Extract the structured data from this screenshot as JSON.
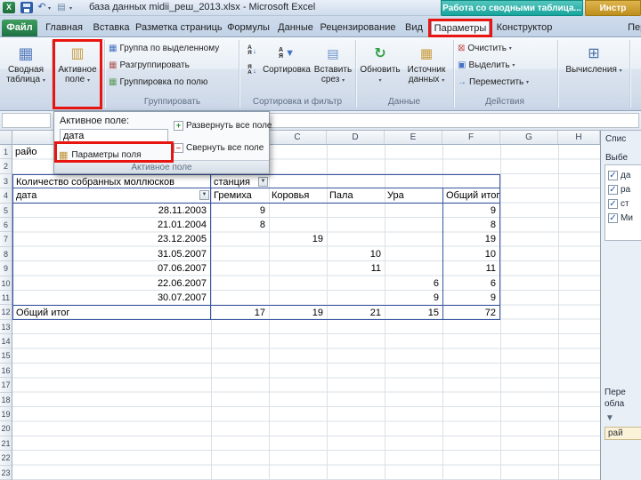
{
  "icons": {
    "logo_letter": "X",
    "undo": "↶",
    "caret": "▾",
    "dropdown_arrow": "▼",
    "check": "✓",
    "refresh": "↻",
    "plus": "+",
    "minus": "–",
    "arrow_down": "↓",
    "letter_a": "А",
    "letter_ya": "Я",
    "funnel": "▼",
    "clear_glyph": "⊠",
    "select_glyph": "▣",
    "move_glyph": "→",
    "grid_glyph": "▦",
    "calc_glyph": "⊞",
    "field_glyph": "▥",
    "settings_glyph": "▦",
    "sheet_glyph": "▤"
  },
  "titlebar": {
    "title": "база данных midii_реш_2013.xlsx - Microsoft Excel",
    "ctx_pivot": "Работа со сводными таблица...",
    "ctx_other": "Инстр"
  },
  "tabs": [
    {
      "label": "Файл",
      "kind": "file"
    },
    {
      "label": "Главная",
      "kind": "plain"
    },
    {
      "label": "Вставка",
      "kind": "plain"
    },
    {
      "label": "Разметка страницы",
      "kind": "plain"
    },
    {
      "label": "Формулы",
      "kind": "plain"
    },
    {
      "label": "Данные",
      "kind": "plain"
    },
    {
      "label": "Рецензирование",
      "kind": "plain"
    },
    {
      "label": "Вид",
      "kind": "plain"
    },
    {
      "label": "Параметры",
      "kind": "active"
    },
    {
      "label": "Конструктор",
      "kind": "plain"
    },
    {
      "label": "Перь",
      "kind": "plain"
    }
  ],
  "ribbon": {
    "pivot_table": "Сводная таблица",
    "active_field": "Активное поле",
    "grouping": {
      "item1": "Группа по выделенному",
      "item2": "Разгруппировать",
      "item3": "Группировка по полю",
      "label": "Группировать"
    },
    "sorting": {
      "sort": "Сортировка",
      "slicer1": "Вставить",
      "slicer2": "срез",
      "label": "Сортировка и фильтр"
    },
    "data": {
      "refresh": "Обновить",
      "source1": "Источник",
      "source2": "данных",
      "label": "Данные"
    },
    "actions": {
      "item1": "Очистить",
      "item2": "Выделить",
      "item3": "Переместить",
      "label": "Действия"
    },
    "calculations": "Вычисления"
  },
  "dropdown": {
    "label": "Активное поле:",
    "value": "дата",
    "settings": "Параметры поля",
    "expand": "Развернуть все поле",
    "collapse": "Свернуть все поле",
    "footer": "Активное поле"
  },
  "sheet": {
    "col_letters": [
      "",
      "",
      "C",
      "D",
      "E",
      "F",
      "G",
      "H"
    ],
    "row_numbers": [
      "1",
      "2",
      "3",
      "4",
      "5",
      "6",
      "7",
      "8",
      "9",
      "10",
      "11",
      "12",
      "13",
      "14",
      "15",
      "16",
      "17",
      "18",
      "19",
      "20",
      "21",
      "22",
      "23"
    ]
  },
  "pivot": {
    "a1": "райо",
    "title": "Количество собранных моллюсков",
    "station": "станция",
    "row_field": "дата",
    "columns": [
      "Гремиха",
      "Коровья",
      "Пала",
      "Ура",
      "Общий итог"
    ],
    "rows": [
      {
        "label": "28.11.2003",
        "values": [
          "9",
          "",
          "",
          "",
          "9"
        ]
      },
      {
        "label": "21.01.2004",
        "values": [
          "8",
          "",
          "",
          "",
          "8"
        ]
      },
      {
        "label": "23.12.2005",
        "values": [
          "",
          "19",
          "",
          "",
          "19"
        ]
      },
      {
        "label": "31.05.2007",
        "values": [
          "",
          "",
          "10",
          "",
          "10"
        ]
      },
      {
        "label": "07.06.2007",
        "values": [
          "",
          "",
          "11",
          "",
          "11"
        ]
      },
      {
        "label": "22.06.2007",
        "values": [
          "",
          "",
          "",
          "6",
          "6"
        ]
      },
      {
        "label": "30.07.2007",
        "values": [
          "",
          "",
          "",
          "9",
          "9"
        ]
      }
    ],
    "total_label": "Общий итог",
    "totals": [
      "17",
      "19",
      "21",
      "15",
      "72"
    ]
  },
  "pane": {
    "title": "Спис",
    "choose": "Выбе",
    "fields": [
      {
        "label": "да",
        "checked": true
      },
      {
        "label": "ра",
        "checked": true
      },
      {
        "label": "ст",
        "checked": true
      },
      {
        "label": "Ми",
        "checked": true
      }
    ],
    "drag1": "Пере",
    "drag2": "обла",
    "chip": "рай"
  }
}
